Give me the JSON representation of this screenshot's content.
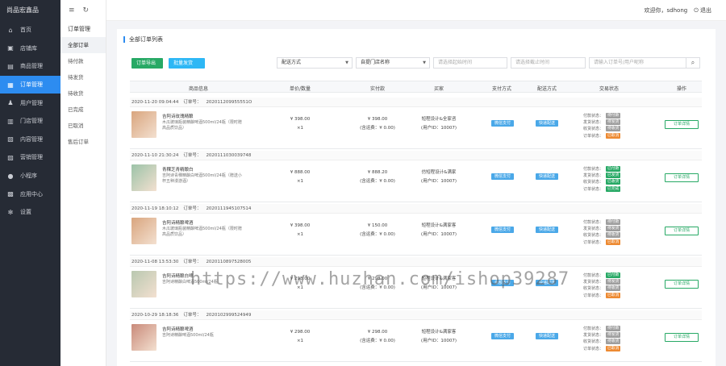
{
  "sidebar": {
    "brand": "尚品宏鑫品",
    "items": [
      {
        "icon": "home-icon",
        "label": "首页",
        "glyph": "⌂"
      },
      {
        "icon": "shop-icon",
        "label": "店铺库",
        "glyph": "▣"
      },
      {
        "icon": "goods-icon",
        "label": "商品管理",
        "glyph": "▤"
      },
      {
        "icon": "order-icon",
        "label": "订单管理",
        "glyph": "▦",
        "active": true
      },
      {
        "icon": "user-icon",
        "label": "用户管理",
        "glyph": "♟"
      },
      {
        "icon": "store-icon",
        "label": "门店管理",
        "glyph": "▥"
      },
      {
        "icon": "content-icon",
        "label": "内容管理",
        "glyph": "▧"
      },
      {
        "icon": "marketing-icon",
        "label": "营销管理",
        "glyph": "▨"
      },
      {
        "icon": "miniapp-icon",
        "label": "小程序",
        "glyph": "●"
      },
      {
        "icon": "app-center-icon",
        "label": "应用中心",
        "glyph": "▩"
      },
      {
        "icon": "settings-icon",
        "label": "设置",
        "glyph": "✻"
      }
    ]
  },
  "submenu": {
    "title": "订单管理",
    "items": [
      {
        "label": "全部订单",
        "active": true
      },
      {
        "label": "待付款"
      },
      {
        "label": "待发货"
      },
      {
        "label": "待收货"
      },
      {
        "label": "已完成"
      },
      {
        "label": "已取消"
      },
      {
        "label": "售后订单"
      }
    ]
  },
  "header": {
    "menu_icon": "≡",
    "refresh_icon": "↻",
    "welcome": "欢迎你，sdhong",
    "logout": "⏻ 退出"
  },
  "main": {
    "title": "全部订单列表",
    "export_btn": "订单导出",
    "batch_btn": "批量发货",
    "delivery_select": "配送方式",
    "store_select": "自提门店名称",
    "start_date_placeholder": "请选择起始时间",
    "end_date_placeholder": "请选择截止时间",
    "search_placeholder": "请输入订单号/用户昵称",
    "columns": [
      "商品信息",
      "单价/数量",
      "实付款",
      "买家",
      "支付方式",
      "配送方式",
      "交易状态",
      "操作"
    ]
  },
  "orders": [
    {
      "time": "2020-11-20 09:04:44",
      "order_label": "订单号：",
      "order_no": "202011209955551O",
      "product": "吉阿诗玫瑰精酿",
      "desc": "木瓜玻璃瓶装精酿啤酒500ml/24瓶（限时赠高品质饮品）",
      "price": "¥ 398.00",
      "qty": "×1",
      "paid": "¥ 398.00",
      "freight": "(含运费：¥ 0.00)",
      "buyer": "短程设计&全家咨",
      "buyer_id": "(用户ID：10007)",
      "pay": "微信支付",
      "ship": "快递配送",
      "states": [
        [
          "付款状态：",
          "待付款",
          "#9e9e9e"
        ],
        [
          "发货状态：",
          "待发货",
          "#9e9e9e"
        ],
        [
          "收货状态：",
          "待收货",
          "#9e9e9e"
        ],
        [
          "订单状态：",
          "已取消",
          "#ed8a32"
        ]
      ],
      "op": "订单详情",
      "thumb": "#d9a57e"
    },
    {
      "time": "2020-11-10 21:30:24",
      "order_label": "订单号：",
      "order_no": "2020111030039748",
      "product": "青稞芝青精酿白",
      "desc": "吉阿诗青稞精酿白啤酒500ml/24瓶（赠送小杯五种漫游酒）",
      "price": "¥ 888.00",
      "qty": "×1",
      "paid": "¥ 888.20",
      "freight": "(含运费：¥ 0.00)",
      "buyer": "仿短程设计&满家",
      "buyer_id": "(用户ID：10007)",
      "pay": "微信支付",
      "ship": "快递配送",
      "states": [
        [
          "付款状态：",
          "已付款",
          "#27a965"
        ],
        [
          "发货状态：",
          "已发货",
          "#27a965"
        ],
        [
          "收货状态：",
          "已收货",
          "#27a965"
        ],
        [
          "订单状态：",
          "已完成",
          "#27a965"
        ]
      ],
      "op": "订单详情",
      "thumb": "#9cc3a8"
    },
    {
      "time": "2020-11-19 18:10:12",
      "order_label": "订单号：",
      "order_no": "2020111945107514",
      "product": "吉阿诗精酿啤酒",
      "desc": "木瓜玻璃瓶装精酿啤酒500ml/24瓶（限时赠高品质饮品）",
      "price": "¥ 398.00",
      "qty": "×1",
      "paid": "¥ 150.00",
      "freight": "(含运费：¥ 0.00)",
      "buyer": "短程设计&满家客",
      "buyer_id": "(用户ID：10007)",
      "pay": "微信支付",
      "ship": "快递配送",
      "states": [
        [
          "付款状态：",
          "待付款",
          "#9e9e9e"
        ],
        [
          "发货状态：",
          "待发货",
          "#9e9e9e"
        ],
        [
          "收货状态：",
          "待收货",
          "#9e9e9e"
        ],
        [
          "订单状态：",
          "已取消",
          "#ed8a32"
        ]
      ],
      "op": "订单详情",
      "thumb": "#d9a57e"
    },
    {
      "time": "2020-11-08 13:53:30",
      "order_label": "订单号：",
      "order_no": "2020110897528005",
      "product": "吉阿诗精酿白啤",
      "desc": "吉阿诗精酿白啤酒500ml/24瓶",
      "price": "¥ 298.00",
      "qty": "×1",
      "paid": "¥ 298.00",
      "freight": "(含运费：¥ 0.00)",
      "buyer": "短程设计&满家客",
      "buyer_id": "(用户ID：10007)",
      "pay": "余额支付",
      "ship": "快递配送",
      "states": [
        [
          "付款状态：",
          "已付款",
          "#27a965"
        ],
        [
          "发货状态：",
          "待发货",
          "#9e9e9e"
        ],
        [
          "收货状态：",
          "待收货",
          "#9e9e9e"
        ],
        [
          "订单状态：",
          "已取消",
          "#ed8a32"
        ]
      ],
      "op": "订单详情",
      "thumb": "#b9c8b0"
    },
    {
      "time": "2020-10-29 18:18:36",
      "order_label": "订单号：",
      "order_no": "2020102999524949",
      "product": "吉阿诗精酿啤酒",
      "desc": "吉阿诗精酿啤酒500ml/24瓶",
      "price": "¥ 298.00",
      "qty": "×1",
      "paid": "¥ 298.00",
      "freight": "(含运费：¥ 0.00)",
      "buyer": "短程设计&满家客",
      "buyer_id": "(用户ID：10007)",
      "pay": "微信支付",
      "ship": "快递配送",
      "states": [
        [
          "付款状态：",
          "待付款",
          "#9e9e9e"
        ],
        [
          "发货状态：",
          "待发货",
          "#9e9e9e"
        ],
        [
          "收货状态：",
          "待收货",
          "#9e9e9e"
        ],
        [
          "订单状态：",
          "已取消",
          "#ed8a32"
        ]
      ],
      "op": "订单详情",
      "thumb": "#c98a7a"
    }
  ],
  "watermark": "https://www.huzhan.com/ishop39287"
}
